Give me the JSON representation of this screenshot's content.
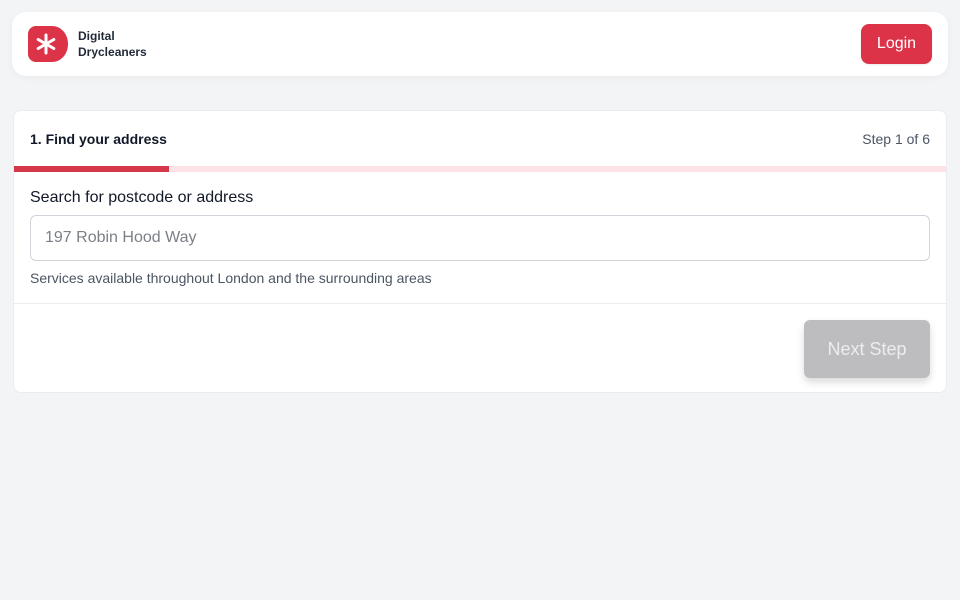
{
  "brand": {
    "line1": "Digital",
    "line2": "Drycleaners",
    "color": "#dd3349"
  },
  "header": {
    "login_label": "Login"
  },
  "step": {
    "title": "1. Find your address",
    "counter": "Step 1 of 6",
    "current": 1,
    "total": 6
  },
  "search": {
    "label": "Search for postcode or address",
    "placeholder": "197 Robin Hood Way",
    "value": "",
    "help": "Services available throughout London and the surrounding areas"
  },
  "actions": {
    "next_label": "Next Step",
    "next_disabled": true
  },
  "icons": {
    "logo": "asterisk-logo-icon"
  }
}
